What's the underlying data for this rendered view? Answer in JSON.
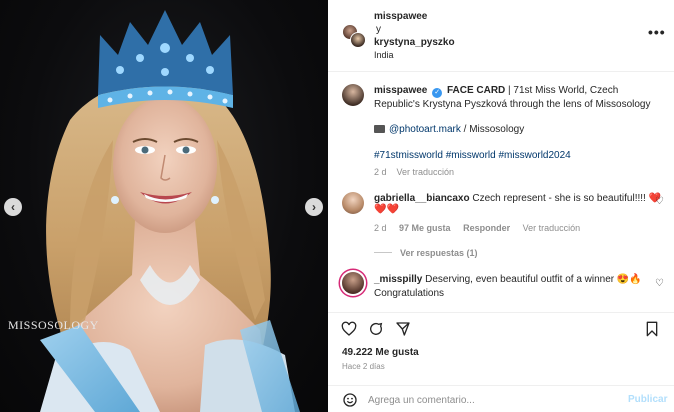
{
  "photo": {
    "prev_glyph": "‹",
    "next_glyph": "›",
    "watermark": "MISSOSOLOGY"
  },
  "header": {
    "user1": "misspawee",
    "connector": "y",
    "user2": "krystyna_pyszko",
    "location": "India",
    "more_glyph": "•••"
  },
  "caption": {
    "username": "misspawee",
    "verified_glyph": "✓",
    "headline": "FACE CARD",
    "text": " | 71st Miss World, Czech Republic's Krystyna Pyszková through the lens of Missosology",
    "credit_link": "@photoart.mark",
    "credit_sep": " / Missosology",
    "hashtags": "#71stmissworld #missworld #missworld2024",
    "time": "2 d",
    "translate": "Ver traducción"
  },
  "comments": [
    {
      "username": "gabriella__biancaxo",
      "text": "Czech represent - she is so beautiful!!!! ❤️",
      "text_line2": "❤️❤️",
      "time": "2 d",
      "likes": "97 Me gusta",
      "reply": "Responder",
      "translate": "Ver traducción"
    },
    {
      "username": "_misspilly",
      "text": "Deserving, even beautiful outfit of a winner 😍🔥",
      "text_line2": "Congratulations"
    }
  ],
  "view_replies": "Ver respuestas (1)",
  "likes_count": "49.222 Me gusta",
  "posted_ago": "Hace 2 días",
  "comment_box": {
    "placeholder": "Agrega un comentario...",
    "post_label": "Publicar"
  },
  "icons": [
    "heart-icon",
    "comment-icon",
    "share-icon",
    "bookmark-icon",
    "emoji-icon",
    "camera-icon",
    "verified-icon",
    "more-icon"
  ]
}
